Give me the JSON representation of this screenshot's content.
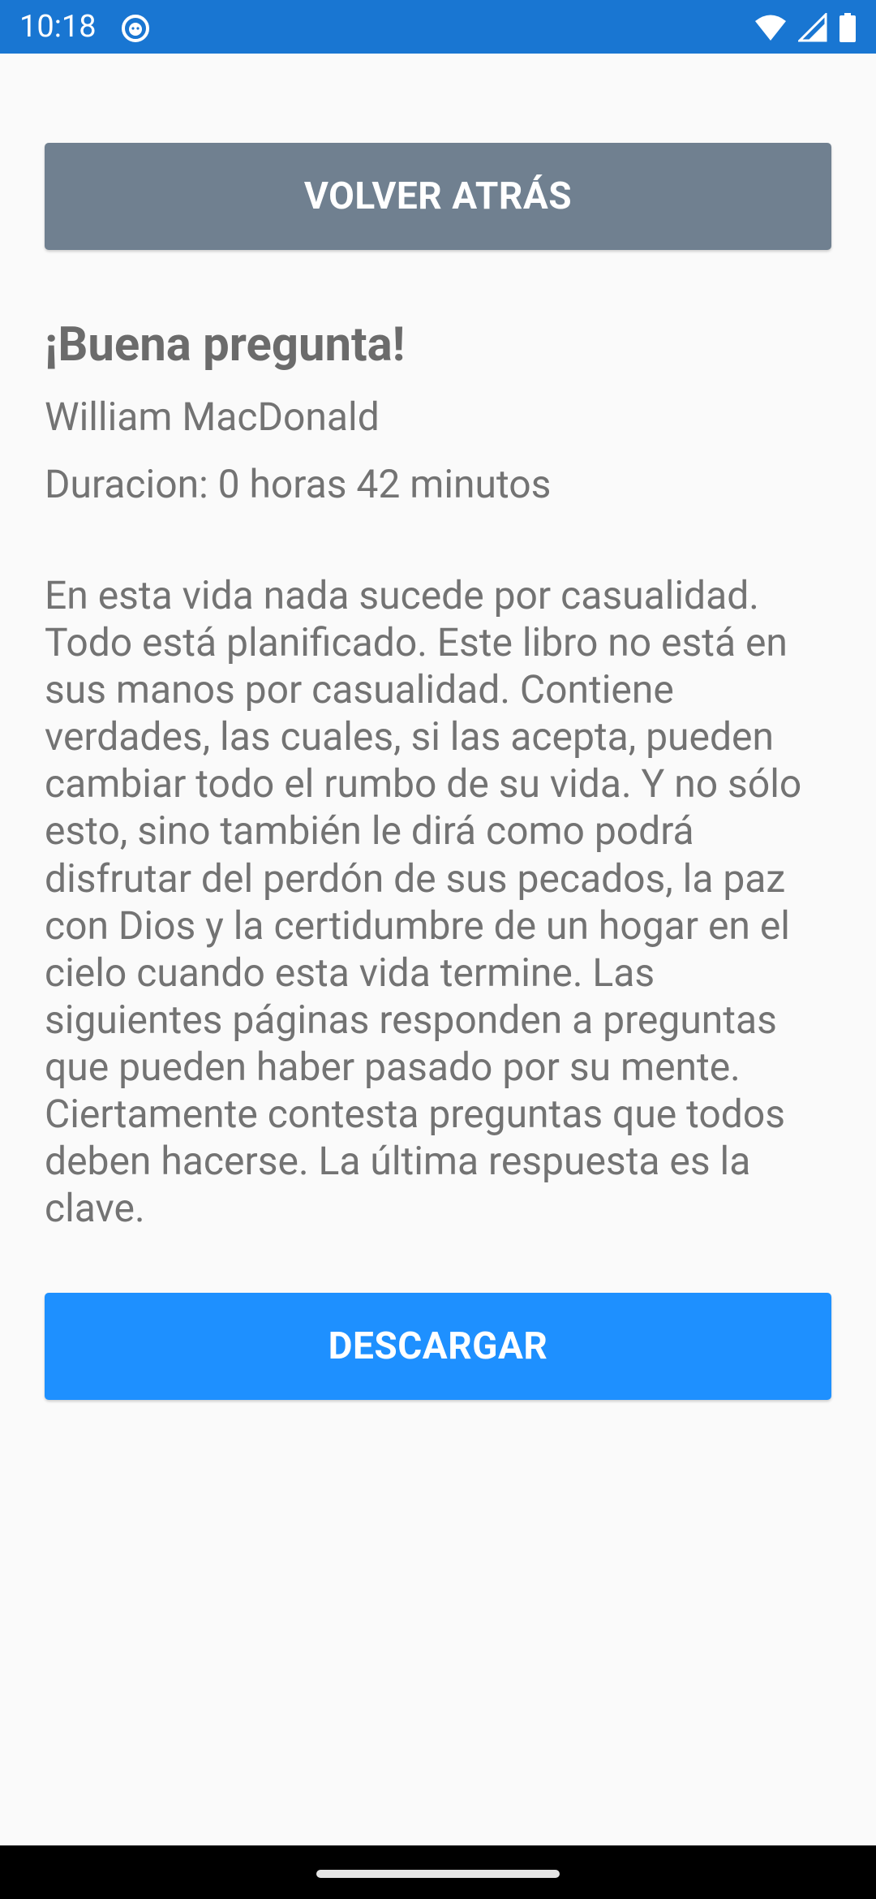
{
  "status_bar": {
    "time": "10:18",
    "app_icon": "cat-face-icon",
    "icons": [
      "wifi-icon",
      "cellular-signal-icon",
      "battery-icon"
    ],
    "background": "#1976d2"
  },
  "back_button": {
    "label": "VOLVER ATRÁS",
    "color": "#708090"
  },
  "book": {
    "title": "¡Buena pregunta!",
    "author": "William MacDonald",
    "duration": "Duracion: 0 horas 42 minutos",
    "description": "En esta vida nada sucede por casualidad. Todo está planificado. Este libro no está en sus manos por casualidad. Contiene verdades, las cuales, si las acepta, pueden cambiar todo el rumbo de su vida. Y no sólo esto, sino también le dirá como podrá disfrutar del perdón de sus pecados, la paz con Dios y la certidumbre de un hogar en el cielo cuando esta vida termine. Las siguientes páginas responden a preguntas que pueden haber pasado por su mente. Ciertamente contesta preguntas que todos deben hacerse. La última respuesta es la clave."
  },
  "download_button": {
    "label": "DESCARGAR",
    "color": "#1e90ff"
  }
}
